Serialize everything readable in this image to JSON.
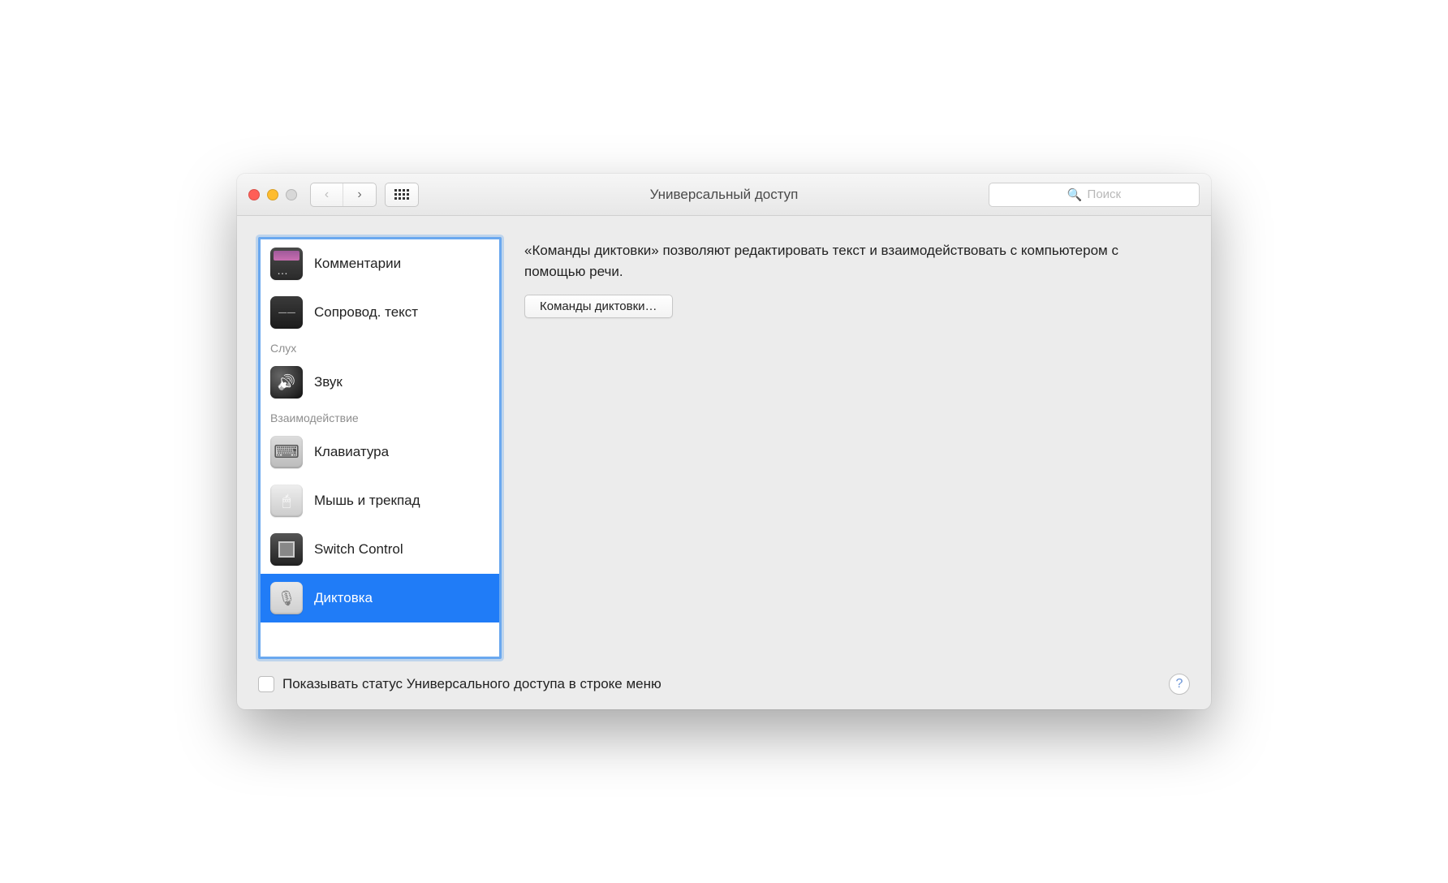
{
  "window": {
    "title": "Универсальный доступ"
  },
  "search": {
    "placeholder": "Поиск"
  },
  "sidebar": {
    "items": {
      "comments": "Комментарии",
      "captions": "Сопровод. текст",
      "sound": "Звук",
      "keyboard": "Клавиатура",
      "mouse": "Мышь и трекпад",
      "switch": "Switch Control",
      "dictation": "Диктовка"
    },
    "sections": {
      "hearing": "Слух",
      "interaction": "Взаимодействие"
    }
  },
  "main": {
    "description": "«Команды диктовки» позволяют редактировать текст и взаимодействовать с компьютером с помощью речи.",
    "button": "Команды диктовки…"
  },
  "footer": {
    "checkbox_label": "Показывать статус Универсального доступа в строке меню"
  }
}
